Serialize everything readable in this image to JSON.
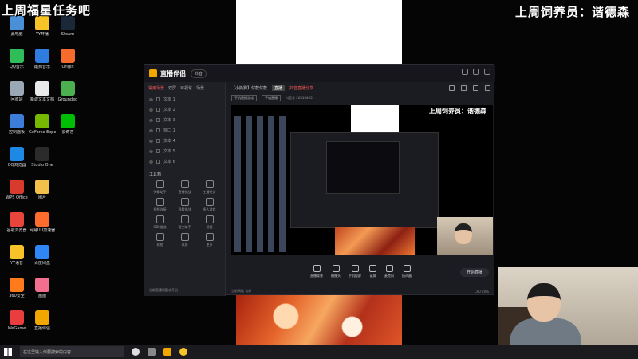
{
  "overlay": {
    "top_left": "上周福星任务吧",
    "top_right": "上周饲养员：谐德森"
  },
  "desktop_icons": [
    {
      "label": "此电脑",
      "color": "#4a90d9"
    },
    {
      "label": "QQ音乐",
      "color": "#2ebd59"
    },
    {
      "label": "回收站",
      "color": "#9aa7b5"
    },
    {
      "label": "控制面板",
      "color": "#3b7dd8"
    },
    {
      "label": "QQ浏览器",
      "color": "#1e88e5"
    },
    {
      "label": "WPS Office",
      "color": "#d83b2b"
    },
    {
      "label": "谷歌浏览器",
      "color": "#e8453c"
    },
    {
      "label": "YY语音",
      "color": "#f7c327"
    },
    {
      "label": "360安全",
      "color": "#ff7a1a"
    },
    {
      "label": "WeGame",
      "color": "#ea3d3d"
    },
    {
      "label": "YY开播",
      "color": "#f7c327"
    },
    {
      "label": "酷狗音乐",
      "color": "#2f7de1"
    },
    {
      "label": "新建文本文档",
      "color": "#e9e9e9"
    },
    {
      "label": "GeForce Experience",
      "color": "#76b900"
    },
    {
      "label": "Studio One",
      "color": "#2b2b2b"
    },
    {
      "label": "图片",
      "color": "#f3c04a"
    },
    {
      "label": "网易UU加速器",
      "color": "#fd6b2f"
    },
    {
      "label": "百度网盘",
      "color": "#2f86f6"
    },
    {
      "label": "画图",
      "color": "#f36f8f"
    },
    {
      "label": "直播伴侣",
      "color": "#f1a600"
    },
    {
      "label": "Steam",
      "color": "#1b2838"
    },
    {
      "label": "Origin",
      "color": "#f56c2d"
    },
    {
      "label": "Grounded",
      "color": "#4caf50"
    },
    {
      "label": "爱奇艺",
      "color": "#00be06"
    }
  ],
  "app": {
    "title": "直播伴侣",
    "version_pill": "抖音",
    "sidebar_tabs": [
      "常用场景",
      "双屏",
      "可视化",
      "场景"
    ],
    "layers": [
      "文本 1",
      "文本 2",
      "文本 3",
      "窗口 1",
      "文本 4",
      "文本 5",
      "文本 6"
    ],
    "tools_heading": "工具箱",
    "tools": [
      "弹幕助手",
      "直播挑战",
      "主播任务",
      "视频连接",
      "观看挑战",
      "多人游戏",
      "OBS推流",
      "悟空助手",
      "滤镜",
      "礼物",
      "录屏",
      "更多"
    ],
    "sidebar_footer": "当前直播间暂未开启",
    "header_tag": "直播",
    "header_title": "【小奶狗】付款付款",
    "header_hot": "抖音直播分享",
    "sub_chips": [
      "手机直播游戏",
      "手机直播"
    ],
    "sub_info": "抖音号 20316405",
    "preview_text": "上周饲养员：谐德森",
    "toolbar": [
      "直播背景",
      "摄像头",
      "手机投屏",
      "录屏",
      "麦克风",
      "扬声器"
    ],
    "golive": "开始直播",
    "status_left": "当前网络 良好",
    "status_right": "CPU 20%"
  },
  "taskbar": {
    "search_placeholder": "在这里输入你要搜索的内容"
  }
}
